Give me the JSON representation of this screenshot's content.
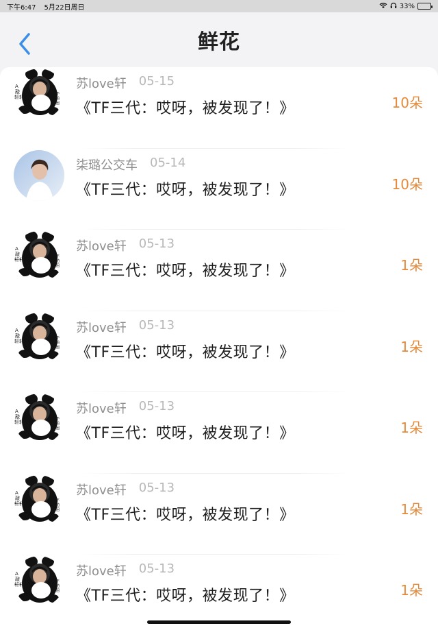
{
  "status_bar": {
    "time": "下午6:47",
    "date": "5月22日周日",
    "battery": "33%"
  },
  "header": {
    "title": "鲜花"
  },
  "items": [
    {
      "user": "苏love轩",
      "date": "05-15",
      "title": "《TF三代：哎呀，被发现了！》",
      "count": "10朵",
      "avatar": "panda-avatar-icon"
    },
    {
      "user": "柒璐公交车",
      "date": "05-14",
      "title": "《TF三代：哎呀，被发现了！》",
      "count": "10朵",
      "avatar": "photo-avatar"
    },
    {
      "user": "苏love轩",
      "date": "05-13",
      "title": "《TF三代：哎呀，被发现了！》",
      "count": "1朵",
      "avatar": "panda-avatar-icon"
    },
    {
      "user": "苏love轩",
      "date": "05-13",
      "title": "《TF三代：哎呀，被发现了！》",
      "count": "1朵",
      "avatar": "panda-avatar-icon"
    },
    {
      "user": "苏love轩",
      "date": "05-13",
      "title": "《TF三代：哎呀，被发现了！》",
      "count": "1朵",
      "avatar": "panda-avatar-icon"
    },
    {
      "user": "苏love轩",
      "date": "05-13",
      "title": "《TF三代：哎呀，被发现了！》",
      "count": "1朵",
      "avatar": "panda-avatar-icon"
    },
    {
      "user": "苏love轩",
      "date": "05-13",
      "title": "《TF三代：哎呀，被发现了！》",
      "count": "1朵",
      "avatar": "panda-avatar-icon"
    }
  ],
  "colors": {
    "accent": "#3a8ee6",
    "count": "#e68a3a"
  }
}
